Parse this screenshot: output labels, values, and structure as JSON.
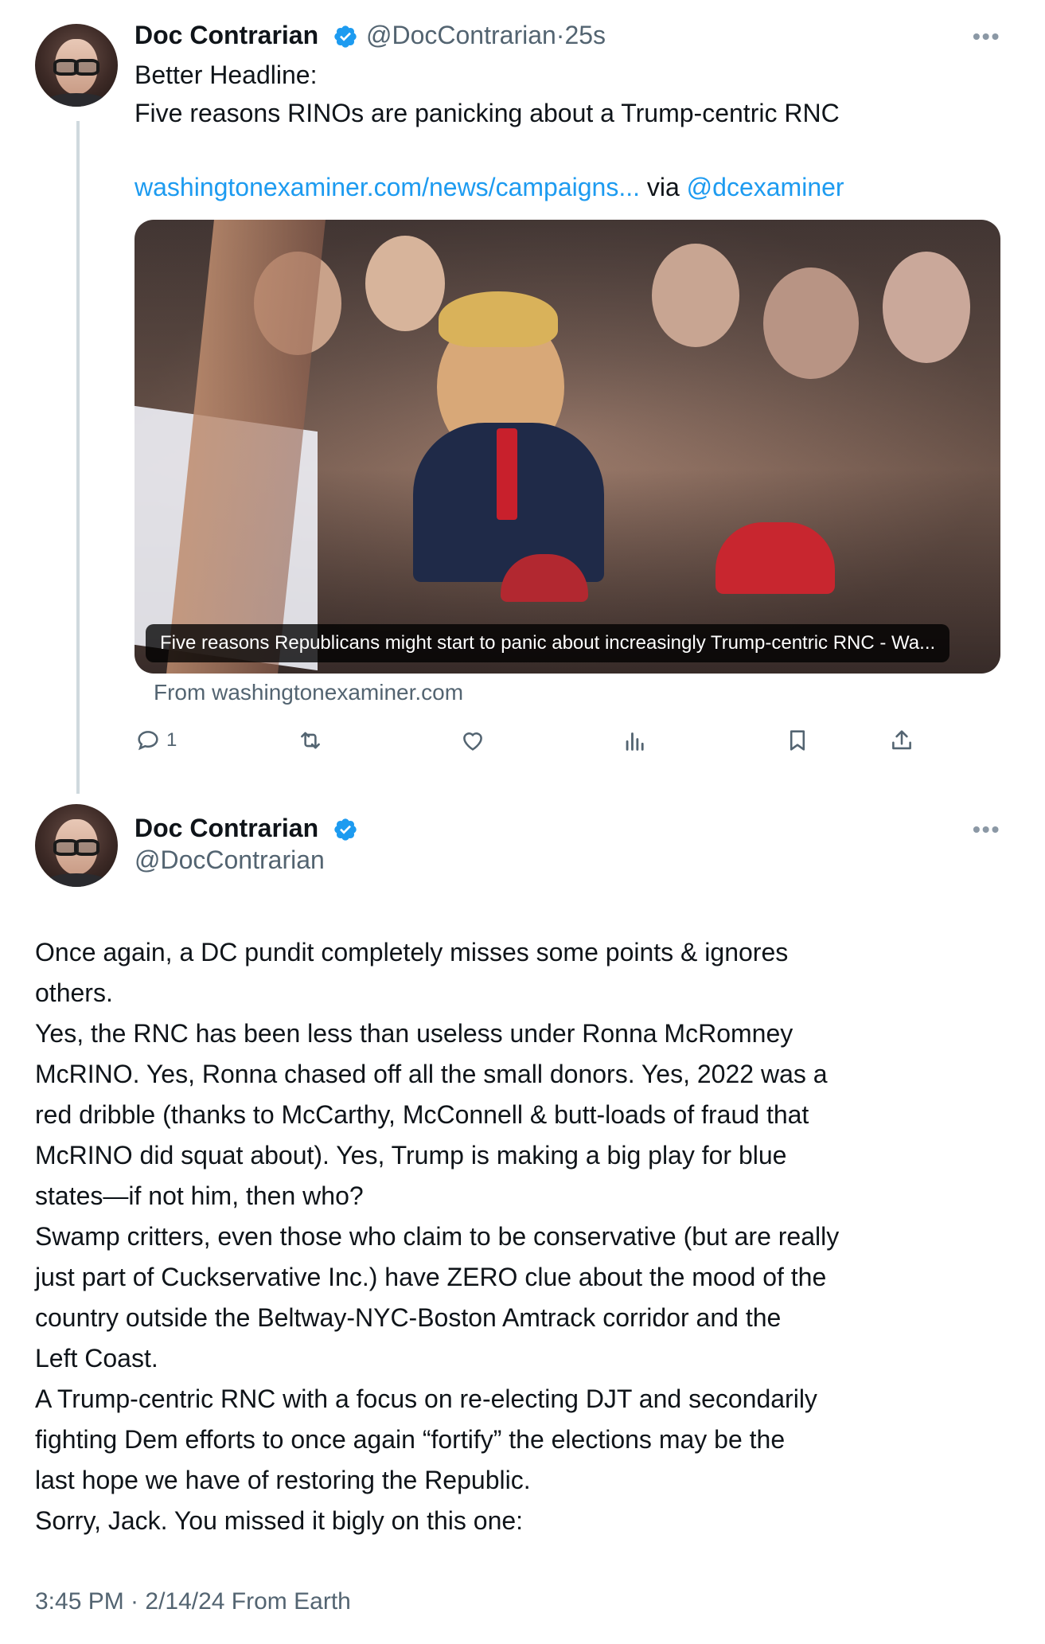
{
  "tweet1": {
    "author_name": "Doc Contrarian",
    "handle": "@DocContrarian",
    "separator": "·",
    "time_ago": "25s",
    "more_label": "•••",
    "lines": [
      "Better Headline:",
      "Five reasons RINOs are panicking about a Trump-centric RNC"
    ],
    "link_text": "washingtonexaminer.com/news/campaigns...",
    "via_text": " via ",
    "via_handle": "@dcexaminer",
    "card": {
      "caption": "Five reasons Republicans might start to panic about increasingly Trump-centric RNC - Wa...",
      "source": "From washingtonexaminer.com"
    },
    "actions": {
      "reply_count": "1"
    }
  },
  "tweet2": {
    "author_name": "Doc Contrarian",
    "handle": "@DocContrarian",
    "more_label": "•••",
    "body_lines": [
      "Once again, a DC pundit completely misses some points & ignores",
      "others.",
      "Yes, the RNC has been less than useless under Ronna McRomney",
      "McRINO. Yes, Ronna chased off all the small donors. Yes, 2022 was a",
      "red dribble (thanks to McCarthy, McConnell & butt-loads of fraud that",
      "McRINO did squat about). Yes, Trump is making a big play for blue",
      "states—if not him, then who?",
      "Swamp critters, even those who claim to be conservative (but are really",
      "just part of Cuckservative Inc.) have ZERO clue about the mood of the",
      "country outside the Beltway-NYC-Boston Amtrack corridor and the",
      "Left Coast.",
      "A Trump-centric RNC with a focus on re-electing DJT and secondarily",
      "fighting Dem efforts to once again “fortify” the elections may be the",
      "last hope we have of restoring the Republic.",
      "Sorry, Jack. You missed it bigly on this one:"
    ],
    "timestamp": "3:45 PM · 2/14/24 From Earth"
  },
  "colors": {
    "text": "#0f1419",
    "secondary": "#536471",
    "link": "#1d9bf0",
    "verified": "#1d9bf0",
    "thread_line": "#cfd9de"
  },
  "icons": [
    "verified-badge-icon",
    "more-icon",
    "reply-icon",
    "retweet-icon",
    "like-icon",
    "views-icon",
    "bookmark-icon",
    "share-icon"
  ]
}
